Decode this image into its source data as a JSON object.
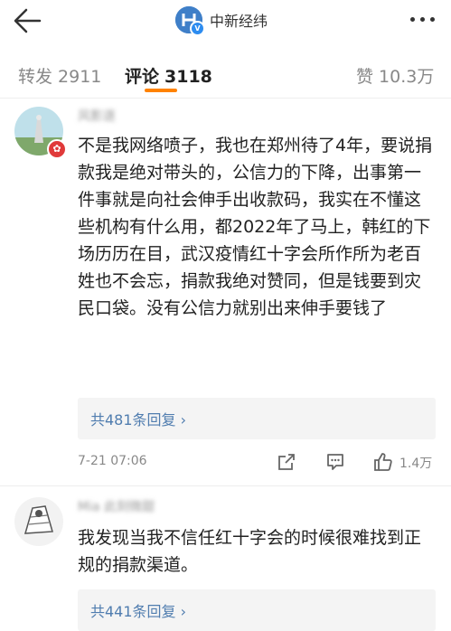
{
  "header": {
    "account_name": "中新经纬",
    "verified_badge": "V"
  },
  "tabs": [
    {
      "label": "转发",
      "count": "2911"
    },
    {
      "label": "评论",
      "count": "3118"
    },
    {
      "label": "赞",
      "count": "10.3万"
    }
  ],
  "comments": [
    {
      "username": "风影逐",
      "text": "不是我网络喷子，我也在郑州待了4年，要说捐款我是绝对带头的，公信力的下降，出事第一件事就是向社会伸手出收款码，我实在不懂这些机构有什么用，都2022年了马上，韩红的下场历历在目，武汉疫情红十字会所作所为老百姓也不会忘，捐款我绝对赞同，但是钱要到灾民口袋。没有公信力就别出来伸手要钱了",
      "replies_label": "共481条回复 ›",
      "time": "7-21 07:06",
      "likes": "1.4万"
    },
    {
      "username": "Mia 此刻微甜",
      "text": "我发现当我不信任红十字会的时候很难找到正规的捐款渠道。",
      "replies_label": "共441条回复 ›"
    }
  ],
  "icons": {
    "back": "arrow-left-icon",
    "more": "more-dots-icon",
    "share": "share-icon",
    "comment": "comment-icon",
    "like": "thumbs-up-icon"
  },
  "colors": {
    "accent": "#ff8200",
    "link": "#507daf",
    "badge": "#e03a3a"
  }
}
